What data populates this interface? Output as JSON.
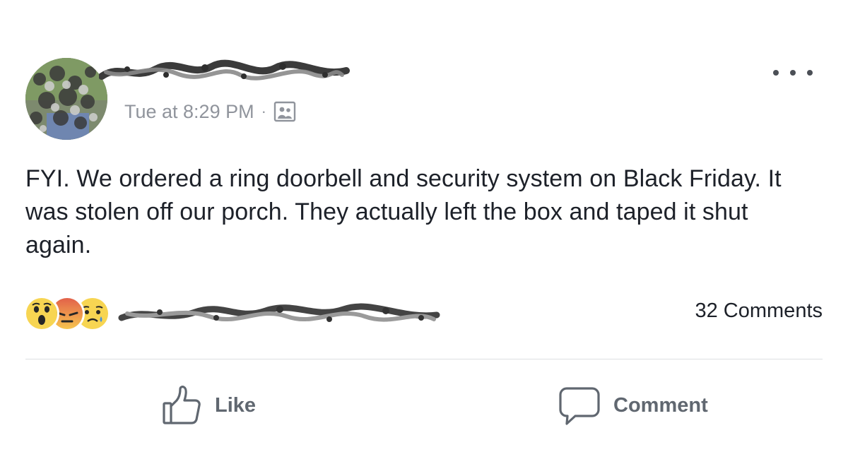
{
  "post": {
    "timestamp": "Tue at 8:29 PM",
    "separator": "·",
    "audience_icon": "photo-audience-icon",
    "more_icon": "more-horizontal-icon",
    "text": "FYI. We ordered a ring doorbell and security system on Black Friday. It was stolen off our porch. They actually left the box and taped it shut again."
  },
  "reactions": {
    "icons": [
      "wow-reaction-icon",
      "angry-reaction-icon",
      "sad-reaction-icon"
    ],
    "comments_count": "32 Comments"
  },
  "actions": {
    "like_label": "Like",
    "like_icon": "thumbs-up-icon",
    "comment_label": "Comment",
    "comment_icon": "speech-bubble-icon"
  },
  "colors": {
    "text": "#1d2129",
    "meta": "#90949c",
    "action": "#606770",
    "divider": "#dddfe2",
    "wow": "#f7d552",
    "angry": "#e2614a",
    "sad": "#f7d552"
  }
}
